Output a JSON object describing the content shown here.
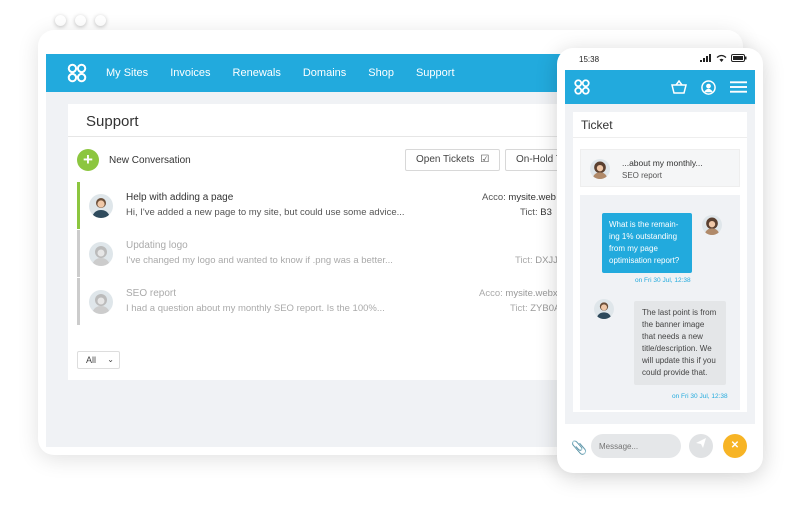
{
  "desktop": {
    "nav": [
      "My Sites",
      "Invoices",
      "Renewals",
      "Domains",
      "Shop",
      "Support"
    ],
    "page_title": "Support",
    "new_conversation": "New Conversation",
    "tabs": {
      "open": "Open Tickets",
      "onhold": "On-Hold T"
    },
    "conversations": [
      {
        "subject": "Help with adding a page",
        "preview": "Hi, I've added a new page to my site, but could use some advice...",
        "account_label": "Acco:",
        "account": "mysite.web",
        "ticket_label": "Tict:",
        "ticket": "B3"
      },
      {
        "subject": "Updating logo",
        "preview": "I've changed my logo and wanted to know if .png was a better...",
        "ticket_label": "Tict:",
        "ticket": "DXJJA"
      },
      {
        "subject": "SEO report",
        "preview": "I had a question about my monthly SEO report. Is the 100%...",
        "account_label": "Acco:",
        "account": "mysite.webx",
        "ticket_label": "Tict:",
        "ticket": "ZYB0A"
      }
    ],
    "filter_select": "All"
  },
  "phone": {
    "time": "15:38",
    "ticket_title": "Ticket",
    "subject_line": "...about my monthly...",
    "subject_sub": "SEO report",
    "msg_out": "What is the remain-ing 1% outstanding from my page optimisation report?",
    "msg_out_time": "on Fri 30 Jul, 12:38",
    "msg_in": "The last point is from the banner image that needs a new title/description. We will update this if you could provide that.",
    "msg_in_time": "on Fri 30 Jul, 12:38",
    "message_placeholder": "Message..."
  },
  "colors": {
    "brand": "#22aadd",
    "green": "#8cc63f",
    "orange": "#f7b425"
  }
}
